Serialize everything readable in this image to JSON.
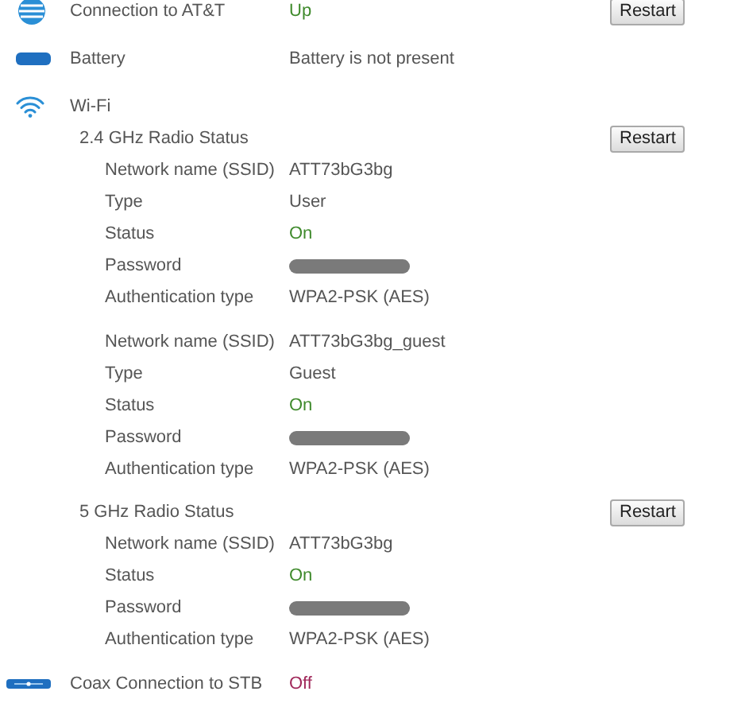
{
  "sections": [
    {
      "kind": "internet",
      "label": "Connection to AT&T",
      "value": "Up",
      "color": "#3f8a2c",
      "button": "Restart"
    },
    {
      "kind": "battery",
      "label": "Battery",
      "value": "Battery is not present"
    },
    {
      "kind": "wifi",
      "label": "Wi-Fi",
      "radios": [
        {
          "title": "2.4 GHz Radio Status",
          "button": "Restart",
          "networks": [
            {
              "fields": [
                {
                  "kind": "text",
                  "label": "Network name (SSID)",
                  "value": "ATT73bG3bg"
                },
                {
                  "kind": "text",
                  "label": "Type",
                  "value": "User"
                },
                {
                  "kind": "status",
                  "label": "Status",
                  "value": "On",
                  "color": "#3f8a2c"
                },
                {
                  "kind": "redacted",
                  "label": "Password"
                },
                {
                  "kind": "text",
                  "label": "Authentication type",
                  "value": "WPA2-PSK (AES)"
                }
              ]
            },
            {
              "fields": [
                {
                  "kind": "text",
                  "label": "Network name (SSID)",
                  "value": "ATT73bG3bg_guest"
                },
                {
                  "kind": "text",
                  "label": "Type",
                  "value": "Guest"
                },
                {
                  "kind": "status",
                  "label": "Status",
                  "value": "On",
                  "color": "#3f8a2c"
                },
                {
                  "kind": "redacted",
                  "label": "Password"
                },
                {
                  "kind": "text",
                  "label": "Authentication type",
                  "value": "WPA2-PSK (AES)"
                }
              ]
            }
          ]
        },
        {
          "title": "5 GHz Radio Status",
          "button": "Restart",
          "networks": [
            {
              "fields": [
                {
                  "kind": "text",
                  "label": "Network name (SSID)",
                  "value": "ATT73bG3bg"
                },
                {
                  "kind": "status",
                  "label": "Status",
                  "value": "On",
                  "color": "#3f8a2c"
                },
                {
                  "kind": "redacted",
                  "label": "Password"
                },
                {
                  "kind": "text",
                  "label": "Authentication type",
                  "value": "WPA2-PSK (AES)"
                }
              ]
            }
          ]
        }
      ]
    },
    {
      "kind": "coax",
      "label": "Coax Connection to STB",
      "value": "Off",
      "color": "#a0285a"
    }
  ]
}
